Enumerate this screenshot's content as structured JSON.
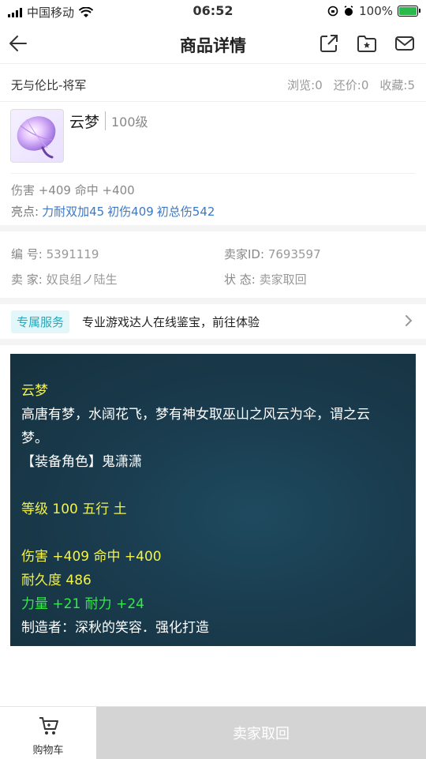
{
  "status_bar": {
    "carrier": "中国移动",
    "time": "06:52",
    "battery": "100%"
  },
  "nav": {
    "title": "商品详情"
  },
  "listing": {
    "title": "无与伦比-将军",
    "views": "浏览:0",
    "bargains": "还价:0",
    "favorites": "收藏:5"
  },
  "item": {
    "name": "云梦",
    "level": "100级",
    "stats": "伤害 +409 命中 +400",
    "highlights_label": "亮点:",
    "highlights": [
      "力耐双加45",
      "初伤409",
      "初总伤542"
    ]
  },
  "info": {
    "id_label": "编  号:",
    "id_value": "5391119",
    "seller_id_label": "卖家ID:",
    "seller_id_value": "7693597",
    "seller_label": "卖  家:",
    "seller_value": "奴良组ノ陆生",
    "status_label": "状  态:",
    "status_value": "卖家取回"
  },
  "service": {
    "tag": "专属服务",
    "text": "专业游戏达人在线鉴宝，前往体验"
  },
  "description": {
    "name": "云梦",
    "lore_line1": "高唐有梦，水阔花飞，梦有神女取巫山之风云为伞，谓之云",
    "lore_line2": "梦。",
    "role": "【装备角色】鬼潇潇",
    "level_line": "等级 100  五行 土",
    "stats_line": "伤害 +409 命中 +400",
    "durability": "耐久度 486",
    "bonus": "力量 +21 耐力 +24",
    "maker": "制造者：深秋的笑容．强化打造"
  },
  "bottom": {
    "cart_label": "购物车",
    "action_label": "卖家取回"
  },
  "colors": {
    "link": "#3a78c8",
    "yellow": "#f3f34a",
    "green": "#35ea4a",
    "tag": "#2aa7b8"
  }
}
